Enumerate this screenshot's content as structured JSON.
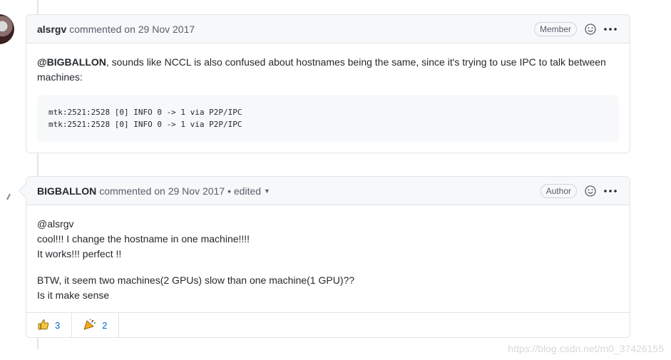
{
  "comments": [
    {
      "author": "alsrgv",
      "meta": "commented on 29 Nov 2017",
      "role": "Member",
      "mention": "@BIGBALLON",
      "text": ", sounds like NCCL is also confused about hostnames being the same, since it's trying to use IPC to talk between machines:",
      "code_lines": [
        "mtk:2521:2528 [0] INFO 0 -> 1 via P2P/IPC",
        "mtk:2521:2528 [0] INFO 0 -> 1 via P2P/IPC"
      ]
    },
    {
      "author": "BIGBALLON",
      "meta": "commented on 29 Nov 2017",
      "edited": "• edited",
      "role": "Author",
      "lines": [
        "@alsrgv",
        "cool!!! I change the hostname in one machine!!!!",
        "It works!!! perfect !!"
      ],
      "lines2": [
        "BTW, it seem two machines(2 GPUs) slow than one machine(1 GPU)??",
        "Is it make sense"
      ],
      "reactions": [
        {
          "icon": "thumbs-up-icon",
          "count": "3"
        },
        {
          "icon": "tada-icon",
          "count": "2"
        }
      ]
    }
  ],
  "watermark": "https://blog.csdn.net/m0_37426155",
  "colors": {
    "link": "#0366d6",
    "border": "#e1e4e8",
    "header_bg": "#f6f8fa"
  }
}
